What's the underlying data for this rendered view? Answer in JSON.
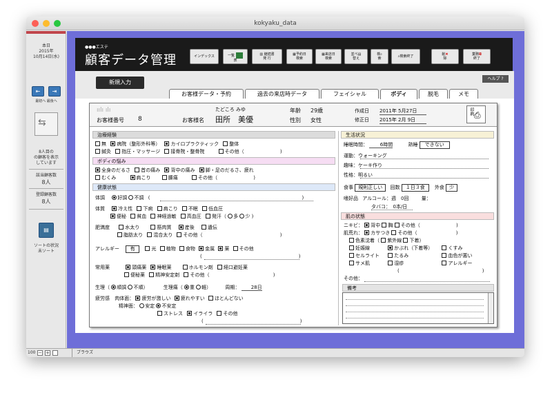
{
  "window": {
    "title": "kokyaku_data"
  },
  "sidebar": {
    "date_label": "本日",
    "date_year": "2015年",
    "date_md": "10月14日(水)",
    "first_label": "最初へ",
    "last_label": "最後へ",
    "record_info": [
      "8人目の",
      "の顧客を表示",
      "しています"
    ],
    "count_label": "該当顧客数",
    "count_value": "8人",
    "total_label": "登録顧客数",
    "total_value": "8人",
    "sort_label": [
      "ソートの状況",
      "未ソート"
    ]
  },
  "statusbar": {
    "zoom": "100",
    "mode": "ブラウズ"
  },
  "header": {
    "logo_small": "●●●エステ",
    "logo": "顧客データ管理",
    "buttons": [
      {
        "l1": "インデックス",
        "l2": ""
      },
      {
        "l1": "一覧",
        "l2": "表"
      },
      {
        "l1": "継続書",
        "l2": "発 行"
      },
      {
        "l1": "予約日",
        "l2": "検索"
      },
      {
        "l1": "来店日",
        "l2": "検索"
      },
      {
        "l1": "並べ",
        "l2": "替え"
      },
      {
        "l1": "検",
        "l2": "索"
      },
      {
        "l1": "検索終了",
        "l2": ""
      },
      {
        "l1": "削",
        "l2": "除"
      },
      {
        "l1": "業務",
        "l2": "終了"
      }
    ]
  },
  "panel": {
    "new_button": "新規入力",
    "help": "ヘルプ ?",
    "tabs": [
      "お客様データ・予約",
      "過去の来店時データ",
      "フェイシャル",
      "ボディ",
      "脱毛",
      "メモ"
    ],
    "active_tab": "ボディ"
  },
  "customer": {
    "number_label": "お客様番号",
    "number": "8",
    "name_label": "お客様名",
    "furigana": "たどころ みゆ",
    "name": "田所　美優",
    "age_label": "年齢",
    "age": "29歳",
    "gender_label": "性別",
    "gender": "女性",
    "created_label": "作成日",
    "created": "2011年 5月27日",
    "modified_label": "修正日",
    "modified": "2015年 2月 9日",
    "print_label": "印刷"
  },
  "treatment": {
    "title": "治療経験",
    "row1": [
      {
        "t": "無",
        "on": false
      },
      {
        "t": "病院（整形外科等）",
        "on": true
      },
      {
        "t": "カイロプラクティック",
        "on": true
      },
      {
        "t": "整体",
        "on": false
      }
    ],
    "row2": [
      {
        "t": "鍼灸",
        "on": false
      },
      {
        "t": "指圧・マッサージ",
        "on": false
      },
      {
        "t": "接骨院・整骨院",
        "on": false
      },
      {
        "t": "その他（",
        "on": false
      }
    ]
  },
  "pain": {
    "title": "ボディの悩み",
    "row1": [
      {
        "t": "全身のだるさ",
        "on": true
      },
      {
        "t": "首の痛み",
        "on": false
      },
      {
        "t": "背中の痛み",
        "on": true
      },
      {
        "t": "脚・足のだるさ、疲れ",
        "on": true
      }
    ],
    "row2": [
      {
        "t": "むくみ",
        "on": false
      },
      {
        "t": "肩こり",
        "on": true
      },
      {
        "t": "腰痛",
        "on": false
      },
      {
        "t": "その他（",
        "on": false
      }
    ]
  },
  "health": {
    "title": "健康状態",
    "cond_label": "体調",
    "cond_good": "好調",
    "cond_bad": "不調",
    "body_label": "体質",
    "body_row1": [
      {
        "t": "冷え性",
        "on": true
      },
      {
        "t": "下痢",
        "on": false
      },
      {
        "t": "肩こり",
        "on": false
      },
      {
        "t": "不眠",
        "on": false
      },
      {
        "t": "低血圧",
        "on": false
      }
    ],
    "body_row2": [
      {
        "t": "便秘",
        "on": true
      },
      {
        "t": "貧血",
        "on": false
      },
      {
        "t": "神経過敏",
        "on": false
      },
      {
        "t": "高血圧",
        "on": false
      },
      {
        "t": "発汗（",
        "on": false
      }
    ],
    "sweat_more": "多",
    "sweat_less": "少",
    "obese_label": "肥満度",
    "obese_row1": [
      {
        "t": "水太り",
        "on": false
      },
      {
        "t": "筋肉質",
        "on": false
      },
      {
        "t": "産後",
        "on": true
      },
      {
        "t": "遺伝",
        "on": false
      }
    ],
    "obese_row2": [
      {
        "t": "脂肪太り",
        "on": false
      },
      {
        "t": "混合太り",
        "on": false
      },
      {
        "t": "その他（",
        "on": false
      }
    ],
    "allergy_label": "アレルギー",
    "allergy_value": "有",
    "allergy_items": [
      {
        "t": "光",
        "on": false
      },
      {
        "t": "植物",
        "on": false
      },
      {
        "t": "食物",
        "on": false
      },
      {
        "t": "金属",
        "on": true
      },
      {
        "t": "薬",
        "on": true
      },
      {
        "t": "その他",
        "on": false
      }
    ],
    "med_label": "常用薬",
    "med_row1": [
      {
        "t": "頭痛薬",
        "on": true
      },
      {
        "t": "睡眠薬",
        "on": true
      },
      {
        "t": "ホルモン剤",
        "on": false
      },
      {
        "t": "経口避妊薬",
        "on": false
      }
    ],
    "med_row2": [
      {
        "t": "便秘薬",
        "on": false
      },
      {
        "t": "精神安定剤",
        "on": false
      },
      {
        "t": "その他（",
        "on": false
      }
    ],
    "period_label": "生理",
    "period_ok": "順調",
    "period_ng": "不順",
    "pain_label": "生理痛",
    "pain_heavy": "重",
    "pain_light": "軽",
    "cycle_label": "周期：",
    "cycle": "28日",
    "fatigue_label": "疲労感",
    "fatigue_body": "肉体面：",
    "fatigue_row1": [
      {
        "t": "疲労が激しい",
        "on": true
      },
      {
        "t": "疲れやすい",
        "on": true
      },
      {
        "t": "ほとんどない",
        "on": false
      }
    ],
    "fatigue_mind": "精神面：",
    "mind_ok": "安定",
    "mind_ng": "不安定",
    "fatigue_row2": [
      {
        "t": "ストレス",
        "on": false
      },
      {
        "t": "イライラ",
        "on": true
      },
      {
        "t": "その他",
        "on": false
      }
    ]
  },
  "life": {
    "title": "生活状況",
    "sleep_label": "睡眠時間：",
    "sleep": "6時間",
    "sleep_q_label": "熟睡",
    "sleep_q": "できない",
    "exercise_label": "運動：",
    "exercise": "ウォーキング",
    "hobby_label": "趣味：",
    "hobby": "ケーキ作り",
    "personality_label": "性格：",
    "personality": "明るい",
    "meal_label": "食事",
    "meal_value": "規則正しい",
    "times_label": "回数",
    "times_value": "１日３食",
    "eatout_label": "外食",
    "eatout_value": "少",
    "pref_label": "嗜好品",
    "alcohol": "アルコール：週　0回",
    "amount_label": "量：",
    "tobacco": "タバコ：　0本/日"
  },
  "skin": {
    "title": "肌の状態",
    "acne_label": "ニキビ：",
    "acne": [
      {
        "t": "背中",
        "on": true
      },
      {
        "t": "胸",
        "on": false
      },
      {
        "t": "その他（",
        "on": false
      }
    ],
    "rough_label": "肌荒れ：",
    "rough": [
      {
        "t": "カサつき",
        "on": true
      },
      {
        "t": "その他（",
        "on": false
      }
    ],
    "row3": [
      {
        "t": "色素沈着（",
        "on": false
      },
      {
        "t": "紫外線",
        "on": false
      },
      {
        "t": "下着）",
        "on": false
      }
    ],
    "row4": [
      {
        "t": "妊娠線",
        "on": false
      },
      {
        "t": "かぶれ（下着等）",
        "on": true
      },
      {
        "t": "くすみ",
        "on": false
      }
    ],
    "row5": [
      {
        "t": "セルライト",
        "on": false
      },
      {
        "t": "たるみ",
        "on": false
      },
      {
        "t": "血色が悪い",
        "on": false
      }
    ],
    "row6": [
      {
        "t": "サメ肌",
        "on": false
      },
      {
        "t": "湿疹",
        "on": false
      },
      {
        "t": "アレルギー",
        "on": false
      }
    ],
    "other_label": "その他："
  },
  "memo": {
    "title": "備考"
  }
}
